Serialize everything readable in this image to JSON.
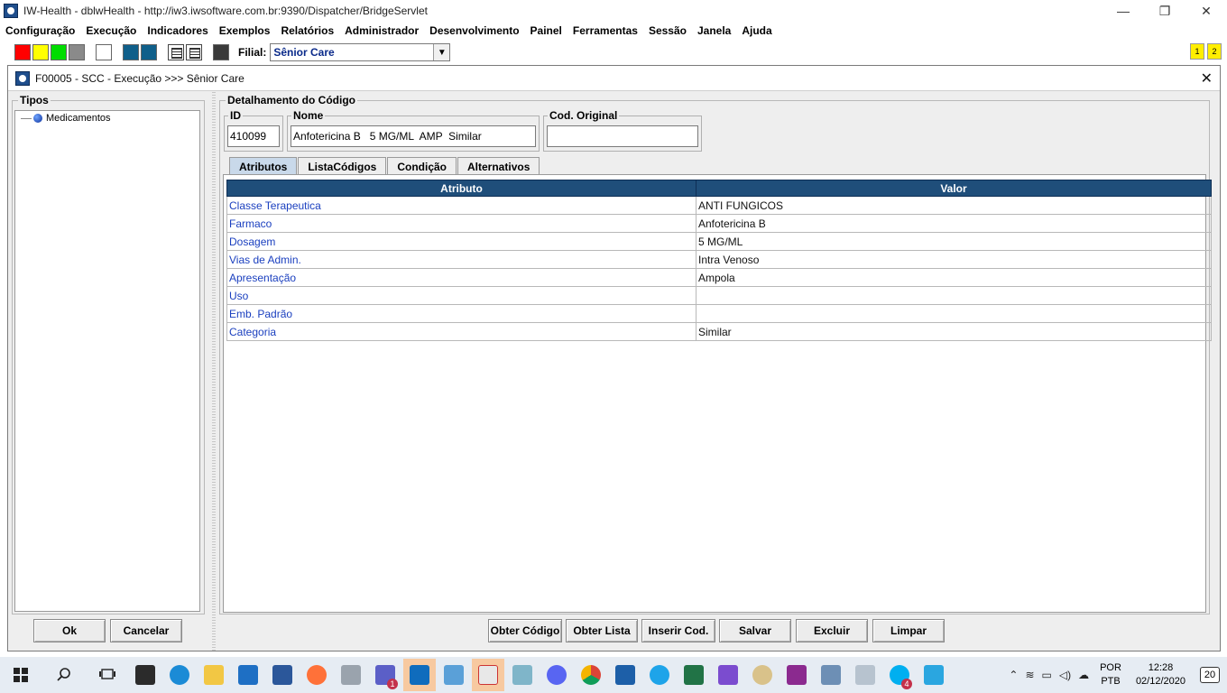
{
  "window": {
    "title": "IW-Health - dblwHealth - http://iw3.iwsoftware.com.br:9390/Dispatcher/BridgeServlet",
    "minimize": "—",
    "restore": "❐",
    "close": "✕"
  },
  "menu": [
    "Configuração",
    "Execução",
    "Indicadores",
    "Exemplos",
    "Relatórios",
    "Administrador",
    "Desenvolvimento",
    "Painel",
    "Ferramentas",
    "Sessão",
    "Janela",
    "Ajuda"
  ],
  "toolbar": {
    "swatch_colors": [
      "#ff0000",
      "#ffff00",
      "#00dd00",
      "#8a8a8a",
      "#ffffff"
    ],
    "swatch2_colors": [
      "#0f5f8a",
      "#0f5f8a"
    ],
    "filial_label": "Filial:",
    "filial_value": "Sênior Care",
    "badges": [
      "1",
      "2"
    ]
  },
  "inner_window": {
    "title": "F00005 - SCC - Execução >>> Sênior Care",
    "close": "✕"
  },
  "left_panel": {
    "group_label": "Tipos",
    "tree_items": [
      "Medicamentos"
    ],
    "ok_label": "Ok",
    "cancel_label": "Cancelar"
  },
  "detail": {
    "group_label": "Detalhamento do Código",
    "id_label": "ID",
    "id_value": "410099",
    "nome_label": "Nome",
    "nome_value": "Anfotericina B   5 MG/ML  AMP  Similar",
    "cod_label": "Cod. Original",
    "cod_value": "",
    "tabs": [
      "Atributos",
      "ListaCódigos",
      "Condição",
      "Alternativos"
    ],
    "table": {
      "headers": [
        "Atributo",
        "Valor"
      ],
      "rows": [
        [
          "Classe Terapeutica",
          "ANTI FUNGICOS"
        ],
        [
          "Farmaco",
          "Anfotericina B"
        ],
        [
          "Dosagem",
          "5 MG/ML"
        ],
        [
          "Vias de Admin.",
          "Intra Venoso"
        ],
        [
          "Apresentação",
          "Ampola"
        ],
        [
          "Uso",
          ""
        ],
        [
          "Emb. Padrão",
          ""
        ],
        [
          "Categoria",
          "Similar"
        ]
      ]
    },
    "buttons": [
      "Obter Código",
      "Obter Lista",
      "Inserir Cod.",
      "Salvar",
      "Excluir",
      "Limpar"
    ]
  },
  "taskbar": {
    "apps": [
      "start-icon",
      "search-icon",
      "task-view-icon",
      "store-icon",
      "edge-icon",
      "explorer-icon",
      "mail-icon",
      "word-icon",
      "firefox-icon",
      "tool-icon",
      "teams-icon",
      "outlook-icon",
      "remote-icon",
      "java-icon",
      "notes-icon",
      "discord-icon",
      "chrome-icon",
      "photos-icon",
      "ie-icon",
      "excel-icon",
      "vs-icon",
      "paint-icon",
      "winrar-icon",
      "box-icon",
      "monitor-icon",
      "skype-icon",
      "app-icon"
    ],
    "teams_badge": "1",
    "skype_badge": "4",
    "lang_top": "POR",
    "lang_bottom": "PTB",
    "time": "12:28",
    "date": "02/12/2020",
    "notifications": "20"
  }
}
